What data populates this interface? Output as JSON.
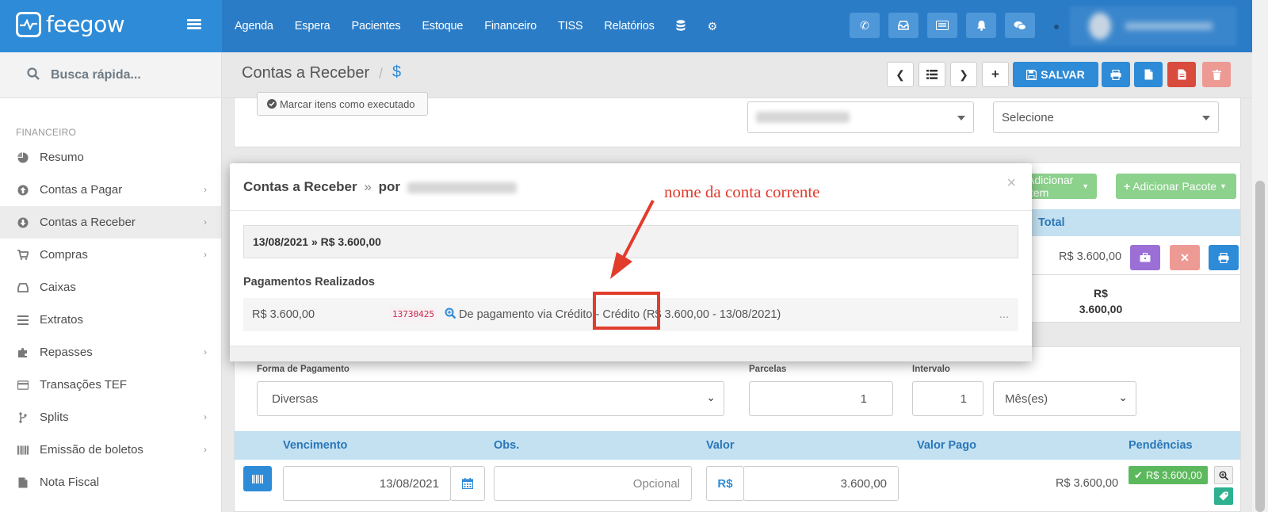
{
  "brand": {
    "name": "feegow"
  },
  "nav": {
    "items": [
      "Agenda",
      "Espera",
      "Pacientes",
      "Estoque",
      "Financeiro",
      "TISS",
      "Relatórios"
    ],
    "icons": [
      "database-icon",
      "gear-icon"
    ],
    "quick_buttons": [
      "phone-icon",
      "inbox-icon",
      "list-card-icon",
      "bell-icon",
      "chat-icon"
    ]
  },
  "sidebar": {
    "search_label": "Busca rápida...",
    "section": "FINANCEIRO",
    "items": [
      {
        "label": "Resumo",
        "icon": "pie-chart-icon",
        "chevron": false
      },
      {
        "label": "Contas a Pagar",
        "icon": "arrow-up-circle-icon",
        "chevron": true
      },
      {
        "label": "Contas a Receber",
        "icon": "arrow-down-circle-icon",
        "chevron": true,
        "active": true
      },
      {
        "label": "Compras",
        "icon": "cart-icon",
        "chevron": true
      },
      {
        "label": "Caixas",
        "icon": "inbox-icon",
        "chevron": false
      },
      {
        "label": "Extratos",
        "icon": "bars-icon",
        "chevron": false
      },
      {
        "label": "Repasses",
        "icon": "puzzle-icon",
        "chevron": true
      },
      {
        "label": "Transações TEF",
        "icon": "credit-card-icon",
        "chevron": false
      },
      {
        "label": "Splits",
        "icon": "branch-icon",
        "chevron": true
      },
      {
        "label": "Emissão de boletos",
        "icon": "barcode-icon",
        "chevron": true
      },
      {
        "label": "Nota Fiscal",
        "icon": "document-icon",
        "chevron": false
      }
    ]
  },
  "header": {
    "title": "Contas a Receber",
    "separator": "/",
    "symbol": "$",
    "save_label": "SALVAR"
  },
  "top_panel": {
    "mark_executed": "Marcar itens como executado",
    "select_right": "Selecione"
  },
  "items_panel": {
    "add_item": "Adicionar Item",
    "add_package": "Adicionar Pacote",
    "total_header": "Total",
    "row_total": "R$ 3.600,00",
    "footer_total_line1": "R$",
    "footer_total_line2": "3.600,00"
  },
  "payment_form": {
    "forma_label": "Forma de Pagamento",
    "forma_value": "Diversas",
    "parcelas_label": "Parcelas",
    "parcelas_value": "1",
    "intervalo_label": "Intervalo",
    "intervalo_value": "1",
    "intervalo_unit": "Mês(es)"
  },
  "installments": {
    "headers": {
      "vencimento": "Vencimento",
      "obs": "Obs.",
      "valor": "Valor",
      "valor_pago": "Valor Pago",
      "pendencias": "Pendências"
    },
    "row": {
      "date": "13/08/2021",
      "obs_placeholder": "Opcional",
      "currency": "R$",
      "valor": "3.600,00",
      "valor_pago": "R$ 3.600,00",
      "pendencia_badge": "R$ 3.600,00"
    }
  },
  "modal": {
    "title": "Contas a Receber",
    "raquo": "»",
    "por": "por",
    "close": "×",
    "dateline": "13/08/2021 » R$ 3.600,00",
    "section": "Pagamentos Realizados",
    "payment": {
      "amount": "R$ 3.600,00",
      "code": "13730425",
      "description": "De pagamento via Crédito - Crédito (R$ 3.600,00 - 13/08/2021)",
      "more": "..."
    }
  },
  "annotation": {
    "text": "nome da conta corrente",
    "color": "#e23c2c"
  },
  "colors": {
    "primary": "#2e8bd7",
    "navbar": "#2b7cc7",
    "success": "#5cb85c",
    "danger": "#d94b3c",
    "purple": "#9b6fd6"
  }
}
